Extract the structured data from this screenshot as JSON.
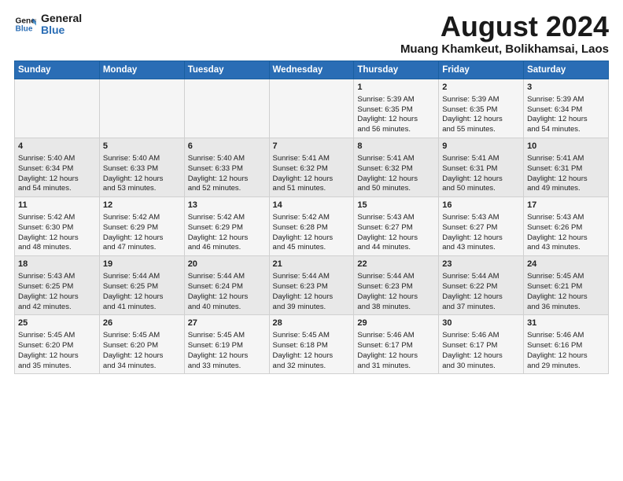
{
  "logo": {
    "line1": "General",
    "line2": "Blue"
  },
  "title": "August 2024",
  "subtitle": "Muang Khamkeut, Bolikhamsai, Laos",
  "days_of_week": [
    "Sunday",
    "Monday",
    "Tuesday",
    "Wednesday",
    "Thursday",
    "Friday",
    "Saturday"
  ],
  "weeks": [
    [
      {
        "day": "",
        "content": ""
      },
      {
        "day": "",
        "content": ""
      },
      {
        "day": "",
        "content": ""
      },
      {
        "day": "",
        "content": ""
      },
      {
        "day": "1",
        "content": "Sunrise: 5:39 AM\nSunset: 6:35 PM\nDaylight: 12 hours\nand 56 minutes."
      },
      {
        "day": "2",
        "content": "Sunrise: 5:39 AM\nSunset: 6:35 PM\nDaylight: 12 hours\nand 55 minutes."
      },
      {
        "day": "3",
        "content": "Sunrise: 5:39 AM\nSunset: 6:34 PM\nDaylight: 12 hours\nand 54 minutes."
      }
    ],
    [
      {
        "day": "4",
        "content": "Sunrise: 5:40 AM\nSunset: 6:34 PM\nDaylight: 12 hours\nand 54 minutes."
      },
      {
        "day": "5",
        "content": "Sunrise: 5:40 AM\nSunset: 6:33 PM\nDaylight: 12 hours\nand 53 minutes."
      },
      {
        "day": "6",
        "content": "Sunrise: 5:40 AM\nSunset: 6:33 PM\nDaylight: 12 hours\nand 52 minutes."
      },
      {
        "day": "7",
        "content": "Sunrise: 5:41 AM\nSunset: 6:32 PM\nDaylight: 12 hours\nand 51 minutes."
      },
      {
        "day": "8",
        "content": "Sunrise: 5:41 AM\nSunset: 6:32 PM\nDaylight: 12 hours\nand 50 minutes."
      },
      {
        "day": "9",
        "content": "Sunrise: 5:41 AM\nSunset: 6:31 PM\nDaylight: 12 hours\nand 50 minutes."
      },
      {
        "day": "10",
        "content": "Sunrise: 5:41 AM\nSunset: 6:31 PM\nDaylight: 12 hours\nand 49 minutes."
      }
    ],
    [
      {
        "day": "11",
        "content": "Sunrise: 5:42 AM\nSunset: 6:30 PM\nDaylight: 12 hours\nand 48 minutes."
      },
      {
        "day": "12",
        "content": "Sunrise: 5:42 AM\nSunset: 6:29 PM\nDaylight: 12 hours\nand 47 minutes."
      },
      {
        "day": "13",
        "content": "Sunrise: 5:42 AM\nSunset: 6:29 PM\nDaylight: 12 hours\nand 46 minutes."
      },
      {
        "day": "14",
        "content": "Sunrise: 5:42 AM\nSunset: 6:28 PM\nDaylight: 12 hours\nand 45 minutes."
      },
      {
        "day": "15",
        "content": "Sunrise: 5:43 AM\nSunset: 6:27 PM\nDaylight: 12 hours\nand 44 minutes."
      },
      {
        "day": "16",
        "content": "Sunrise: 5:43 AM\nSunset: 6:27 PM\nDaylight: 12 hours\nand 43 minutes."
      },
      {
        "day": "17",
        "content": "Sunrise: 5:43 AM\nSunset: 6:26 PM\nDaylight: 12 hours\nand 43 minutes."
      }
    ],
    [
      {
        "day": "18",
        "content": "Sunrise: 5:43 AM\nSunset: 6:25 PM\nDaylight: 12 hours\nand 42 minutes."
      },
      {
        "day": "19",
        "content": "Sunrise: 5:44 AM\nSunset: 6:25 PM\nDaylight: 12 hours\nand 41 minutes."
      },
      {
        "day": "20",
        "content": "Sunrise: 5:44 AM\nSunset: 6:24 PM\nDaylight: 12 hours\nand 40 minutes."
      },
      {
        "day": "21",
        "content": "Sunrise: 5:44 AM\nSunset: 6:23 PM\nDaylight: 12 hours\nand 39 minutes."
      },
      {
        "day": "22",
        "content": "Sunrise: 5:44 AM\nSunset: 6:23 PM\nDaylight: 12 hours\nand 38 minutes."
      },
      {
        "day": "23",
        "content": "Sunrise: 5:44 AM\nSunset: 6:22 PM\nDaylight: 12 hours\nand 37 minutes."
      },
      {
        "day": "24",
        "content": "Sunrise: 5:45 AM\nSunset: 6:21 PM\nDaylight: 12 hours\nand 36 minutes."
      }
    ],
    [
      {
        "day": "25",
        "content": "Sunrise: 5:45 AM\nSunset: 6:20 PM\nDaylight: 12 hours\nand 35 minutes."
      },
      {
        "day": "26",
        "content": "Sunrise: 5:45 AM\nSunset: 6:20 PM\nDaylight: 12 hours\nand 34 minutes."
      },
      {
        "day": "27",
        "content": "Sunrise: 5:45 AM\nSunset: 6:19 PM\nDaylight: 12 hours\nand 33 minutes."
      },
      {
        "day": "28",
        "content": "Sunrise: 5:45 AM\nSunset: 6:18 PM\nDaylight: 12 hours\nand 32 minutes."
      },
      {
        "day": "29",
        "content": "Sunrise: 5:46 AM\nSunset: 6:17 PM\nDaylight: 12 hours\nand 31 minutes."
      },
      {
        "day": "30",
        "content": "Sunrise: 5:46 AM\nSunset: 6:17 PM\nDaylight: 12 hours\nand 30 minutes."
      },
      {
        "day": "31",
        "content": "Sunrise: 5:46 AM\nSunset: 6:16 PM\nDaylight: 12 hours\nand 29 minutes."
      }
    ]
  ]
}
